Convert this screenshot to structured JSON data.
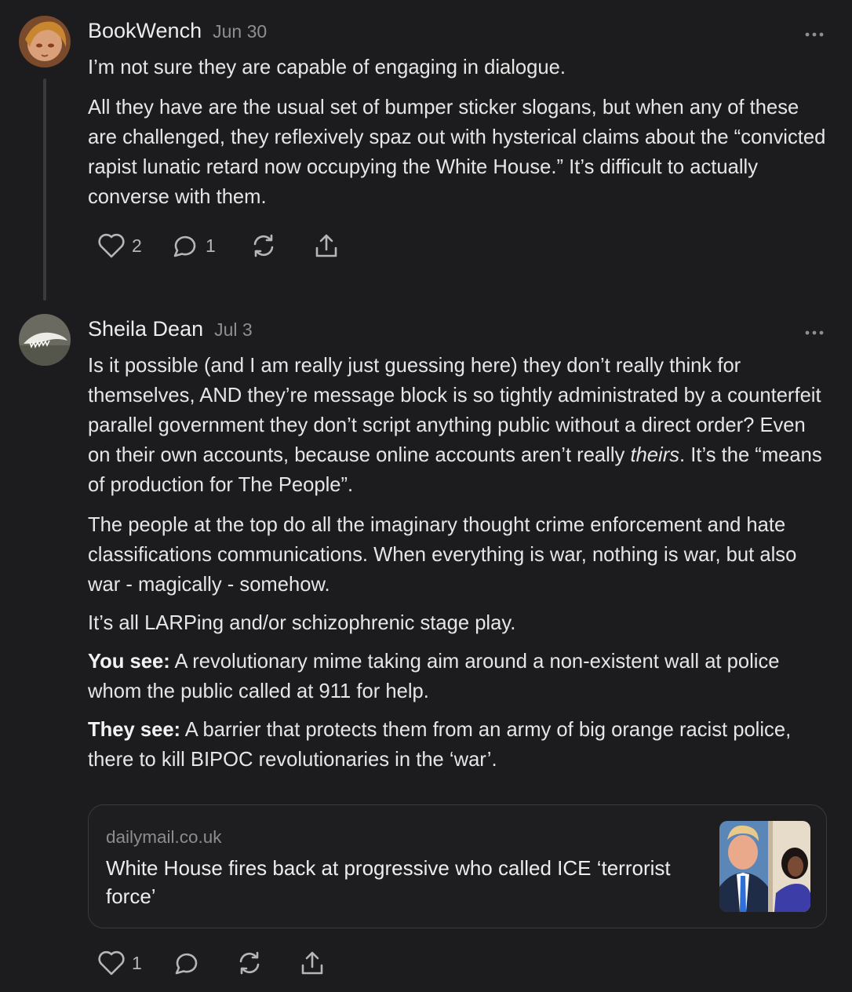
{
  "comments": [
    {
      "author": "BookWench",
      "date": "Jun 30",
      "paragraphs": [
        "I’m not sure they are capable of engaging in dialogue.",
        "All they have are the usual set of bumper sticker slogans, but when any of these are challenged, they reflexively spaz out with hysterical claims about the “convicted rapist lunatic retard now occupying the White House.” It’s difficult to actually converse with them."
      ],
      "likes": "2",
      "replies": "1"
    },
    {
      "author": "Sheila Dean",
      "date": "Jul 3",
      "p1_before": "Is it possible (and I am really just guessing here) they don’t really think for themselves, AND they’re message block is so tightly administrated by a counterfeit parallel government they don’t script anything public without a direct order? Even on their own accounts, because online accounts aren’t really ",
      "p1_em": "theirs",
      "p1_after": ". It’s the “means of production for The People”.",
      "p2": "The people at the top do all the imaginary thought crime enforcement and hate classifications communications. When everything is war, nothing is war, but also war - magically - somehow.",
      "p3": "It’s all LARPing and/or schizophrenic stage play.",
      "p4_label": "You see:",
      "p4_text": " A revolutionary mime taking aim around a non-existent wall at police whom the public called at 911 for help.",
      "p5_label": "They see:",
      "p5_text": " A barrier that protects them from an army of big orange racist police, there to kill BIPOC revolutionaries in the ‘war’.",
      "link": {
        "domain": "dailymail.co.uk",
        "title": "White House fires back at progressive who called ICE ‘terrorist force’"
      },
      "likes": "1"
    }
  ],
  "icons": {
    "like": "heart-icon",
    "reply": "speech-bubble-icon",
    "restack": "restack-icon",
    "share": "share-icon",
    "more": "more-options-icon"
  },
  "colors": {
    "background": "#1c1c1e",
    "text": "#e6e6e7",
    "muted": "#8e8e93"
  }
}
